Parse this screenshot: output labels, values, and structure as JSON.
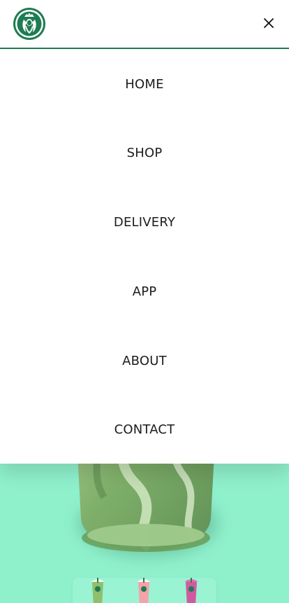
{
  "brand": {
    "logo_icon": "siren-logo-icon",
    "accent_color": "#1e7c52"
  },
  "header": {
    "close_icon": "close-icon"
  },
  "menu": {
    "items": [
      {
        "label": "HOME"
      },
      {
        "label": "SHOP"
      },
      {
        "label": "DELIVERY"
      },
      {
        "label": "APP"
      },
      {
        "label": "ABOUT"
      },
      {
        "label": "CONTACT"
      }
    ]
  },
  "hero": {
    "background_color": "#8ff0cc",
    "product_thumbnails": [
      {
        "icon": "matcha-frappuccino-icon"
      },
      {
        "icon": "strawberry-frappuccino-icon"
      },
      {
        "icon": "berry-frappuccino-icon"
      }
    ]
  }
}
